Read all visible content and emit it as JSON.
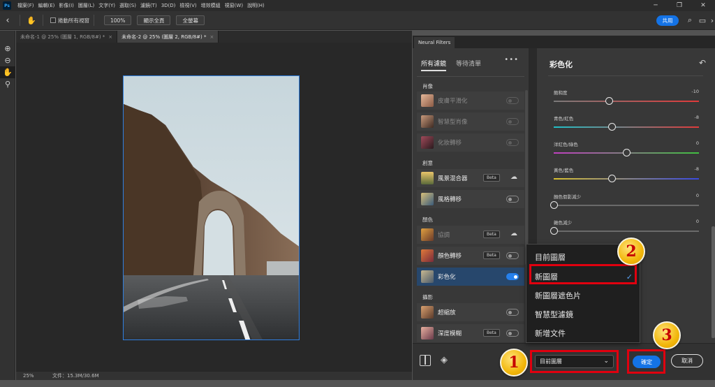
{
  "menubar": {
    "app_icon": "Ps",
    "items": [
      "檔案(F)",
      "編輯(E)",
      "影像(I)",
      "圖層(L)",
      "文字(Y)",
      "選取(S)",
      "濾鏡(T)",
      "3D(D)",
      "檢視(V)",
      "增效模組",
      "視窗(W)",
      "說明(H)"
    ],
    "window_controls": [
      "minimize-icon",
      "restore-icon",
      "close-icon"
    ]
  },
  "options_bar": {
    "scroll_all_label": "捲動所有視窗",
    "btn_100": "100%",
    "btn_fit": "顯示全頁",
    "btn_fill": "全螢幕",
    "share_label": "共用"
  },
  "tools": [
    "zoom-in-icon",
    "zoom-out-icon",
    "hand-icon",
    "magnifier-icon"
  ],
  "doc_tabs": [
    {
      "label": "未命名-1 @ 25% (圖層 1, RGB/8#) *",
      "active": false
    },
    {
      "label": "未命名-2 @ 25% (圖層 2, RGB/8#) *",
      "active": true
    }
  ],
  "status": {
    "zoom": "25%",
    "info": "文件：15.3M/30.6M"
  },
  "neural_filters": {
    "panel_tab": "Neural Filters",
    "tab_all": "所有濾鏡",
    "tab_waitlist": "等待清單",
    "more": "•••",
    "sections": [
      {
        "label": "肖像"
      },
      {
        "label": "創意"
      },
      {
        "label": "顏色"
      },
      {
        "label": "攝影"
      }
    ],
    "filters": [
      {
        "label": "皮膚平滑化",
        "beta": "",
        "state": "dim"
      },
      {
        "label": "智慧型肖像",
        "beta": "",
        "state": "dim"
      },
      {
        "label": "化妝轉移",
        "beta": "",
        "state": "dim"
      },
      {
        "label": "風景混合器",
        "beta": "Beta",
        "state": "cloud"
      },
      {
        "label": "風格轉移",
        "beta": "",
        "state": "off"
      },
      {
        "label": "協調",
        "beta": "Beta",
        "state": "cloud"
      },
      {
        "label": "顏色轉移",
        "beta": "Beta",
        "state": "off"
      },
      {
        "label": "彩色化",
        "beta": "",
        "state": "on"
      },
      {
        "label": "超縮放",
        "beta": "",
        "state": "off"
      },
      {
        "label": "深度模糊",
        "beta": "Beta",
        "state": "off"
      }
    ]
  },
  "colorize": {
    "title": "彩色化",
    "sliders": [
      {
        "label": "飽和度",
        "value": "-10",
        "position": 0.38
      },
      {
        "label": "青色/紅色",
        "value": "-8",
        "position": 0.4
      },
      {
        "label": "洋紅色/綠色",
        "value": "0",
        "position": 0.5
      },
      {
        "label": "黃色/藍色",
        "value": "-8",
        "position": 0.4
      },
      {
        "label": "顏色假影減少",
        "value": "0",
        "position": 0.0
      },
      {
        "label": "雜色減少",
        "value": "0",
        "position": 0.0
      }
    ]
  },
  "output_menu": {
    "options": [
      "目前圖層",
      "新圖層",
      "新圖層遮色片",
      "智慧型濾鏡",
      "新增文件"
    ],
    "checked_index": 1
  },
  "bottom_bar": {
    "output_value": "目前圖層",
    "ok_label": "確定",
    "cancel_label": "取消"
  },
  "steps": [
    "1",
    "2",
    "3"
  ],
  "colors": {
    "accent_blue": "#1473e6",
    "highlight_red": "#e0000f",
    "badge_gold": "#f2b70b",
    "badge_number": "#c60000"
  }
}
